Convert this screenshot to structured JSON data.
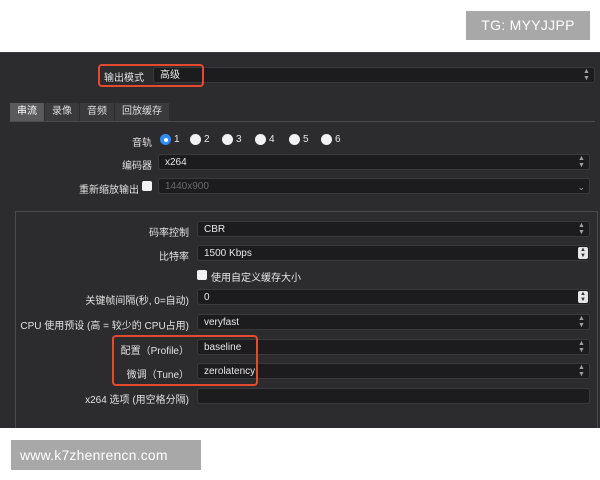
{
  "watermark_top": "TG: MYYJJPP",
  "watermark_bottom": "www.k7zhenrencn.com",
  "output_mode": {
    "label": "输出模式",
    "value": "高级"
  },
  "tabs": [
    "串流",
    "录像",
    "音频",
    "回放缓存"
  ],
  "active_tab": "串流",
  "audio_track": {
    "label": "音轨",
    "options": [
      "1",
      "2",
      "3",
      "4",
      "5",
      "6"
    ],
    "selected": "1"
  },
  "encoder": {
    "label": "编码器",
    "value": "x264"
  },
  "rescale": {
    "label": "重新缩放输出",
    "value": "1440x900",
    "checked": false
  },
  "rate_control": {
    "label": "码率控制",
    "value": "CBR"
  },
  "bitrate": {
    "label": "比特率",
    "value": "1500 Kbps"
  },
  "custom_buffer": {
    "label": "使用自定义缓存大小",
    "checked": false
  },
  "keyframe": {
    "label": "关键帧间隔(秒, 0=自动)",
    "value": "0"
  },
  "cpu_preset": {
    "label": "CPU 使用预设 (高 = 较少的 CPU占用)",
    "value": "veryfast"
  },
  "profile": {
    "label": "配置（Profile）",
    "value": "baseline"
  },
  "tune": {
    "label": "微调（Tune）",
    "value": "zerolatency"
  },
  "x264_options": {
    "label": "x264 选项 (用空格分隔)",
    "value": ""
  },
  "colors": {
    "highlight": "#e64a2e",
    "radio_selected": "#2f8cf5",
    "window_bg": "#2c2c2e"
  }
}
